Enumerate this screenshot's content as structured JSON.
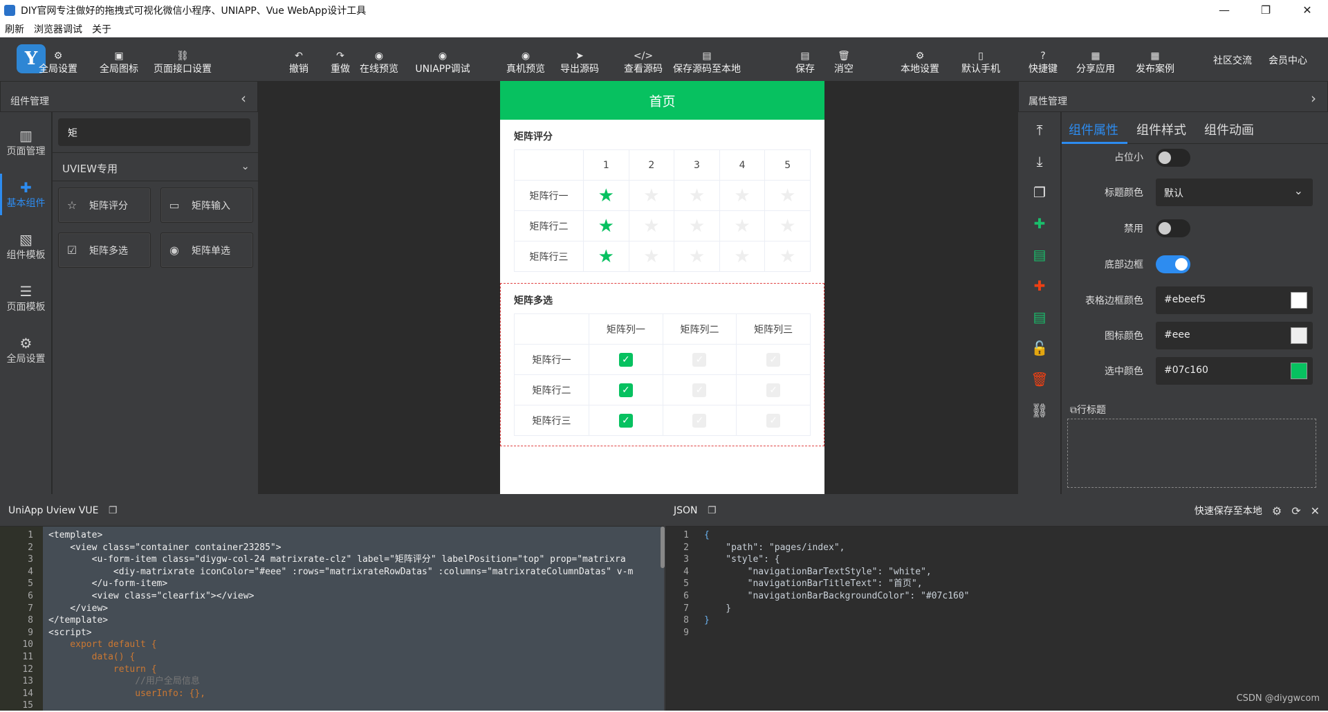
{
  "window": {
    "title": "DIY官网专注做好的拖拽式可视化微信小程序、UNIAPP、Vue WebApp设计工具",
    "controls": [
      "—",
      "❐",
      "✕"
    ]
  },
  "menu": [
    "刷新",
    "浏览器调试",
    "关于"
  ],
  "toolbar": {
    "logo": "Y",
    "left": [
      {
        "label": "全局设置",
        "icon": "gear-window-icon",
        "glyph": "⚙"
      },
      {
        "label": "全局图标",
        "icon": "image-icon",
        "glyph": "▣"
      },
      {
        "label": "页面接口设置",
        "icon": "link-icon",
        "glyph": "⛓"
      }
    ],
    "middle": [
      {
        "label": "撤销",
        "icon": "undo-icon",
        "glyph": "↶"
      },
      {
        "label": "重做",
        "icon": "redo-icon",
        "glyph": "↷"
      },
      {
        "label": "在线预览",
        "icon": "eye-icon",
        "glyph": "◉"
      },
      {
        "label": "UNIAPP调试",
        "icon": "eye-icon",
        "glyph": "◉"
      },
      {
        "label": "真机预览",
        "icon": "eye-icon",
        "glyph": "◉"
      },
      {
        "label": "导出源码",
        "icon": "send-icon",
        "glyph": "➤"
      },
      {
        "label": "查看源码",
        "icon": "code-icon",
        "glyph": "</>"
      },
      {
        "label": "保存源码至本地",
        "icon": "save-icon",
        "glyph": "▤"
      },
      {
        "label": "保存",
        "icon": "save-icon",
        "glyph": "▤"
      },
      {
        "label": "消空",
        "icon": "trash-icon",
        "glyph": "🗑"
      }
    ],
    "right": [
      {
        "label": "本地设置",
        "icon": "gear-icon",
        "glyph": "⚙"
      },
      {
        "label": "默认手机",
        "icon": "phone-icon",
        "glyph": "▯"
      },
      {
        "label": "快捷键",
        "icon": "help-icon",
        "glyph": "?"
      },
      {
        "label": "分享应用",
        "icon": "share-icon",
        "glyph": "▦"
      },
      {
        "label": "发布案例",
        "icon": "publish-icon",
        "glyph": "▦"
      }
    ],
    "plain": [
      "社区交流",
      "会员中心"
    ]
  },
  "left_panel": {
    "title": "组件管理",
    "nav": [
      {
        "label": "页面管理",
        "icon": "pages-icon",
        "glyph": "▥"
      },
      {
        "label": "基本组件",
        "icon": "puzzle-icon",
        "glyph": "✚"
      },
      {
        "label": "组件模板",
        "icon": "template-icon",
        "glyph": "▧"
      },
      {
        "label": "页面模板",
        "icon": "database-icon",
        "glyph": "☰"
      },
      {
        "label": "全局设置",
        "icon": "gear-icon",
        "glyph": "⚙"
      }
    ],
    "search_value": "矩",
    "category": "UVIEW专用",
    "components": [
      {
        "label": "矩阵评分",
        "icon": "star-outline-icon",
        "glyph": "☆"
      },
      {
        "label": "矩阵输入",
        "icon": "input-box-icon",
        "glyph": "▭"
      },
      {
        "label": "矩阵多选",
        "icon": "checkbox-icon",
        "glyph": "☑"
      },
      {
        "label": "矩阵单选",
        "icon": "radio-icon",
        "glyph": "◉"
      }
    ]
  },
  "phone": {
    "header": "首页",
    "rate": {
      "title": "矩阵评分",
      "columns": [
        "1",
        "2",
        "3",
        "4",
        "5"
      ],
      "rows": [
        {
          "label": "矩阵行一",
          "value": 1
        },
        {
          "label": "矩阵行二",
          "value": 1
        },
        {
          "label": "矩阵行三",
          "value": 1
        }
      ]
    },
    "check": {
      "title": "矩阵多选",
      "columns": [
        "矩阵列一",
        "矩阵列二",
        "矩阵列三"
      ],
      "rows": [
        {
          "label": "矩阵行一",
          "checked": [
            true,
            false,
            false
          ]
        },
        {
          "label": "矩阵行二",
          "checked": [
            true,
            false,
            false
          ]
        },
        {
          "label": "矩阵行三",
          "checked": [
            true,
            false,
            false
          ]
        }
      ]
    }
  },
  "right_panel": {
    "title": "属性管理",
    "tabs": [
      "组件属性",
      "组件样式",
      "组件动画"
    ],
    "tools": [
      {
        "icon": "move-top-icon",
        "glyph": "⤒",
        "color": "#e8e8e8"
      },
      {
        "icon": "move-bottom-icon",
        "glyph": "⤓",
        "color": "#e8e8e8"
      },
      {
        "icon": "copy-icon",
        "glyph": "❐",
        "color": "#e8e8e8"
      },
      {
        "icon": "puzzle-add-icon",
        "glyph": "✚",
        "color": "#19be6b"
      },
      {
        "icon": "document-icon",
        "glyph": "▤",
        "color": "#19be6b"
      },
      {
        "icon": "puzzle-remove-icon",
        "glyph": "✚",
        "color": "#ed4014"
      },
      {
        "icon": "document-add-icon",
        "glyph": "▤",
        "color": "#19be6b"
      },
      {
        "icon": "unlock-icon",
        "glyph": "🔓",
        "color": "#e8e8e8"
      },
      {
        "icon": "delete-icon",
        "glyph": "🗑",
        "color": "#ed4014"
      },
      {
        "icon": "link-icon",
        "glyph": "⛓",
        "color": "#e8e8e8"
      }
    ],
    "props": {
      "placeholder_small": {
        "label": "占位小",
        "on": false
      },
      "title_color": {
        "label": "标题颜色",
        "value": "默认"
      },
      "disabled": {
        "label": "禁用",
        "on": false
      },
      "bottom_border": {
        "label": "底部边框",
        "on": true
      },
      "border_color": {
        "label": "表格边框颜色",
        "value": "#ebeef5",
        "swatch": "#ffffff"
      },
      "icon_color": {
        "label": "图标颜色",
        "value": "#eee",
        "swatch": "#eeeeee"
      },
      "active_color": {
        "label": "选中颜色",
        "value": "#07c160",
        "swatch": "#07c160"
      }
    },
    "row_title_section": "行标题"
  },
  "editor_left": {
    "title": "UniApp Uview VUE",
    "line_numbers": [
      "1",
      "2",
      "3",
      "4",
      "5",
      "6",
      "7",
      "8",
      "9",
      "10",
      "11",
      "12",
      "13",
      "14",
      "15"
    ],
    "lines": [
      "<template>",
      "    <view class=\"container container23285\">",
      "        <u-form-item class=\"diygw-col-24 matrixrate-clz\" label=\"矩阵评分\" labelPosition=\"top\" prop=\"matrixra",
      "            <diy-matrixrate iconColor=\"#eee\" :rows=\"matrixrateRowDatas\" :columns=\"matrixrateColumnDatas\" v-m",
      "        </u-form-item>",
      "        <view class=\"clearfix\"></view>",
      "    </view>",
      "</template>",
      "",
      "<script>",
      "    export default {",
      "        data() {",
      "            return {",
      "                //用户全局信息",
      "                userInfo: {},"
    ]
  },
  "editor_right": {
    "title": "JSON",
    "save_label": "快速保存至本地",
    "line_numbers": [
      "1",
      "2",
      "3",
      "4",
      "5",
      "6",
      "7",
      "8",
      "9"
    ],
    "lines": [
      "{",
      "    \"path\": \"pages/index\",",
      "    \"style\": {",
      "        \"navigationBarTextStyle\": \"white\",",
      "        \"navigationBarTitleText\": \"首页\",",
      "        \"navigationBarBackgroundColor\": \"#07c160\"",
      "    }",
      "}",
      ""
    ]
  },
  "watermark": "CSDN @diygwcom",
  "colors": {
    "accent": "#2d8cf0",
    "brand_green": "#07c160",
    "danger": "#ed4014"
  }
}
